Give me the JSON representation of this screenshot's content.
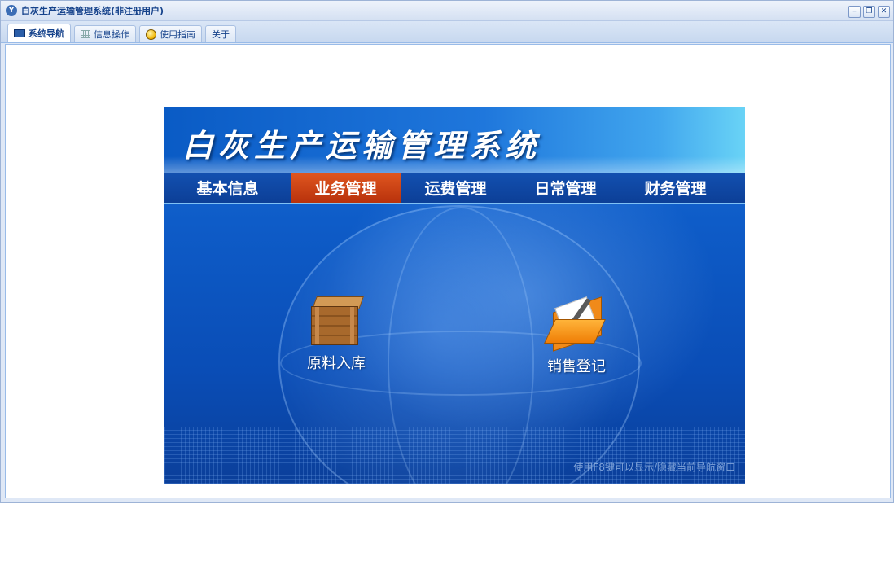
{
  "window": {
    "title": "白灰生产运输管理系统(非注册用户)",
    "buttons": {
      "minimize": "–",
      "restore": "❐",
      "close": "✕"
    }
  },
  "tabs": [
    {
      "label": "系统导航",
      "icon": "monitor-icon",
      "active": true
    },
    {
      "label": "信息操作",
      "icon": "grid-icon",
      "active": false
    },
    {
      "label": "使用指南",
      "icon": "help-icon",
      "active": false
    },
    {
      "label": "关于",
      "icon": "",
      "active": false
    }
  ],
  "banner": {
    "title": "白灰生产运输管理系统",
    "menu": [
      "基本信息",
      "业务管理",
      "运费管理",
      "日常管理",
      "财务管理"
    ],
    "active_menu": "业务管理",
    "shortcuts": [
      {
        "label": "原料入库",
        "icon": "crate-icon"
      },
      {
        "label": "销售登记",
        "icon": "folder-pen-icon"
      }
    ],
    "hint": "使用F8键可以显示/隐藏当前导航窗口"
  },
  "colors": {
    "accent": "#15428b",
    "banner_blue": "#0e5cc8",
    "menu_active": "#c8400f"
  }
}
